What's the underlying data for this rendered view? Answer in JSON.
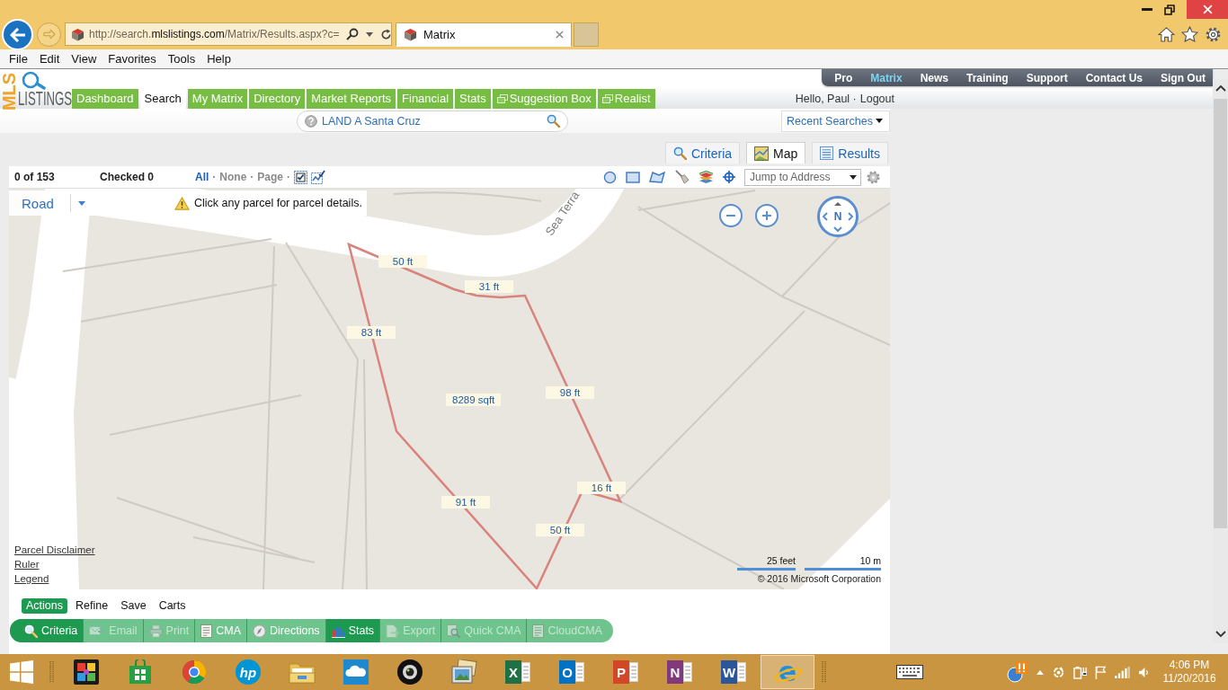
{
  "browser": {
    "tabs": [
      {
        "title": "Matrix",
        "selected": true
      }
    ],
    "address": {
      "prefix": "http://search.",
      "domain": "mlslistings.com",
      "path": "/Matrix/Results.aspx?c="
    },
    "menu": [
      "File",
      "Edit",
      "View",
      "Favorites",
      "Tools",
      "Help"
    ]
  },
  "header": {
    "logo": {
      "mark": "MLS",
      "word": "LISTINGS"
    },
    "utility_nav": [
      {
        "label": "Pro",
        "selected": false
      },
      {
        "label": "Matrix",
        "selected": true
      },
      {
        "label": "News",
        "selected": false
      },
      {
        "label": "Training",
        "selected": false
      },
      {
        "label": "Support",
        "selected": false
      },
      {
        "label": "Contact Us",
        "selected": false
      },
      {
        "label": "Sign Out",
        "selected": false
      }
    ],
    "main_nav": [
      {
        "label": "Dashboard",
        "selected": false,
        "popup": false
      },
      {
        "label": "Search",
        "selected": true,
        "popup": false
      },
      {
        "label": "My Matrix",
        "selected": false,
        "popup": false
      },
      {
        "label": "Directory",
        "selected": false,
        "popup": false
      },
      {
        "label": "Market Reports",
        "selected": false,
        "popup": false
      },
      {
        "label": "Financial",
        "selected": false,
        "popup": false
      },
      {
        "label": "Stats",
        "selected": false,
        "popup": false
      },
      {
        "label": "Suggestion Box",
        "selected": false,
        "popup": true
      },
      {
        "label": "Realist",
        "selected": false,
        "popup": true
      }
    ],
    "user": {
      "greeting": "Hello, Paul",
      "separator": "·",
      "logout": "Logout"
    },
    "quick_search": {
      "label": "LAND A Santa Cruz"
    },
    "recent_searches": "Recent Searches"
  },
  "view_tabs": [
    {
      "label": "Criteria",
      "kind": "search",
      "selected": false
    },
    {
      "label": "Map",
      "kind": "map",
      "selected": true
    },
    {
      "label": "Results",
      "kind": "list",
      "selected": false
    }
  ],
  "map_toolbar": {
    "result_count": "0 of 153",
    "checked_count": "Checked 0",
    "select_links": [
      {
        "label": "All",
        "selected": true,
        "separator": "·"
      },
      {
        "label": "None",
        "selected": false,
        "separator": "·"
      },
      {
        "label": "Page",
        "selected": false,
        "separator": "·"
      }
    ],
    "jump_field": {
      "placeholder": "Jump to Address"
    }
  },
  "map": {
    "style_control": "Road",
    "notice": "Click any parcel for parcel details.",
    "street_label": "Sea Terra",
    "parcel_labels": [
      "50 ft",
      "31 ft",
      "83 ft",
      "8289 sqft",
      "98 ft",
      "16 ft",
      "91 ft",
      "50 ft"
    ],
    "compass": "N",
    "links": [
      "Parcel Disclaimer",
      "Ruler",
      "Legend"
    ],
    "scale": {
      "imperial": "25 feet",
      "metric": "10 m"
    },
    "copyright": "© 2016 Microsoft Corporation"
  },
  "action_tabs": [
    {
      "label": "Actions",
      "selected": true
    },
    {
      "label": "Refine",
      "selected": false
    },
    {
      "label": "Save",
      "selected": false
    },
    {
      "label": "Carts",
      "selected": false
    }
  ],
  "action_buttons": [
    {
      "label": "Criteria",
      "kind": "search",
      "active": true,
      "disabled": false
    },
    {
      "label": "Email",
      "kind": "email",
      "active": false,
      "disabled": true
    },
    {
      "label": "Print",
      "kind": "print",
      "active": false,
      "disabled": true
    },
    {
      "label": "CMA",
      "kind": "document",
      "active": false,
      "disabled": false
    },
    {
      "label": "Directions",
      "kind": "directions",
      "active": false,
      "disabled": false
    },
    {
      "label": "Stats",
      "kind": "chart",
      "active": true,
      "disabled": false
    },
    {
      "label": "Export",
      "kind": "export",
      "active": false,
      "disabled": true
    },
    {
      "label": "Quick CMA",
      "kind": "quick",
      "active": false,
      "disabled": true
    },
    {
      "label": "CloudCMA",
      "kind": "document",
      "active": false,
      "disabled": true
    }
  ],
  "taskbar": {
    "apps": [
      {
        "kind": "puzzle",
        "selected": false
      },
      {
        "kind": "store",
        "selected": false
      },
      {
        "kind": "wheel",
        "selected": false
      },
      {
        "kind": "round",
        "glyph": "hp",
        "color": "#0096d6",
        "selected": false
      },
      {
        "kind": "folder",
        "selected": false
      },
      {
        "kind": "cloud",
        "selected": false
      },
      {
        "kind": "lens",
        "selected": false
      },
      {
        "kind": "photos",
        "selected": false
      },
      {
        "kind": "tile",
        "glyph": "X",
        "color": "#1e7145",
        "selected": false
      },
      {
        "kind": "tile",
        "glyph": "O",
        "color": "#0072c6",
        "selected": false
      },
      {
        "kind": "tile",
        "glyph": "P",
        "color": "#d24726",
        "selected": false
      },
      {
        "kind": "tile",
        "glyph": "N",
        "color": "#80397b",
        "selected": false
      },
      {
        "kind": "tile",
        "glyph": "W",
        "color": "#2b579a",
        "selected": false
      },
      {
        "kind": "ring",
        "glyph": "e",
        "color": "#1e8fe0",
        "selected": true
      }
    ],
    "clock": {
      "time": "4:06 PM",
      "date": "11/20/2016"
    }
  }
}
